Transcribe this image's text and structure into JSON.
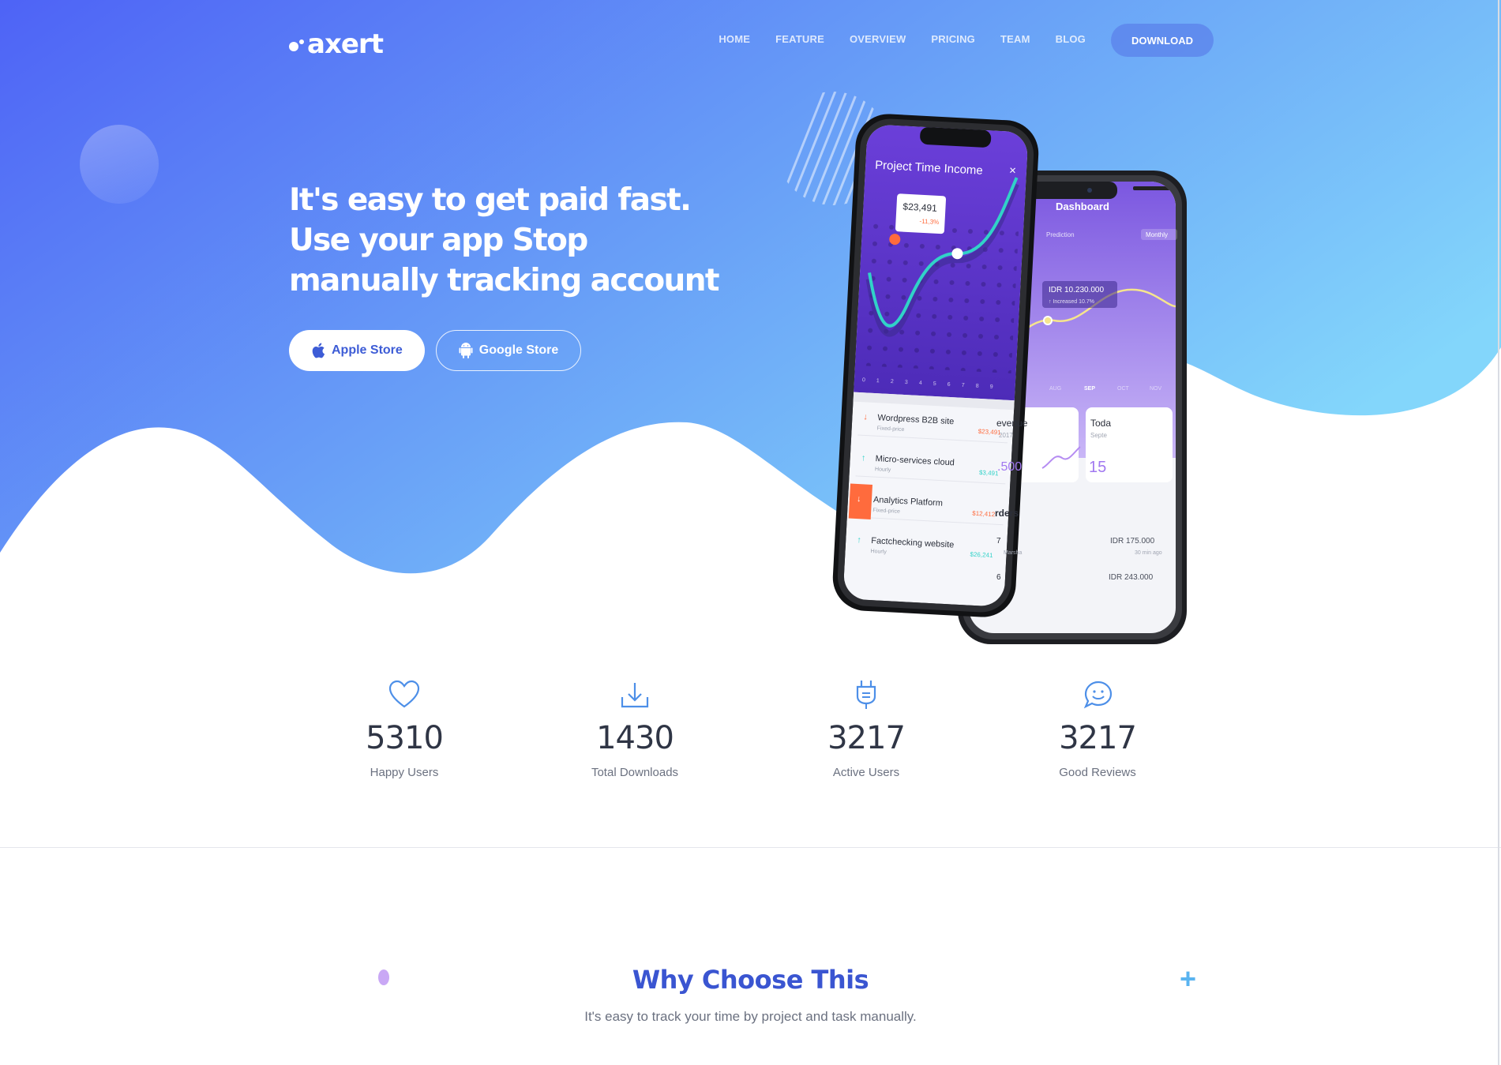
{
  "brand": {
    "name": "axert"
  },
  "nav": {
    "items": [
      {
        "label": "HOME"
      },
      {
        "label": "FEATURE"
      },
      {
        "label": "OVERVIEW"
      },
      {
        "label": "PRICING"
      },
      {
        "label": "TEAM"
      },
      {
        "label": "BLOG"
      }
    ],
    "download_label": "DOWNLOAD"
  },
  "hero": {
    "title": "It's easy to get paid fast. Use your app Stop manually tracking account",
    "apple_button": "Apple Store",
    "google_button": "Google Store"
  },
  "phone_front": {
    "title": "Project Time Income",
    "close": "×",
    "tooltip_value": "$23,491",
    "tooltip_change": "-11,3%",
    "days": [
      "0",
      "1",
      "2",
      "3",
      "4",
      "5",
      "6",
      "7",
      "8",
      "9"
    ],
    "rows": [
      {
        "name": "Wordpress B2B site",
        "sub": "Fixed-price",
        "amount": "$23,491",
        "dir": "down"
      },
      {
        "name": "Micro-services cloud",
        "sub": "Hourly",
        "amount": "$3,491",
        "dir": "up"
      },
      {
        "name": "Analytics Platform",
        "sub": "Fixed-price",
        "amount": "$12,412",
        "dir": "down"
      },
      {
        "name": "Factchecking website",
        "sub": "Hourly",
        "amount": "$26,241",
        "dir": "up"
      }
    ]
  },
  "phone_back": {
    "title": "Dashboard",
    "prediction": "Prediction",
    "period": "Monthly",
    "tooltip_value": "IDR 10.230.000",
    "tooltip_note": "↑ Increased 10.7%",
    "months": [
      "AUG",
      "SEP",
      "OCT",
      "NOV"
    ],
    "card1_title": "evenue",
    "card1_sub": "2017",
    "card1_value": ".500",
    "card2_title": "Toda",
    "card2_sub": "Septe",
    "card2_value": "15",
    "orders_title": "rders",
    "order1_left": "7",
    "order1_name": "Marsha",
    "order1_amount": "IDR 175.000",
    "order1_time": "30 min ago",
    "order2_left": "6",
    "order2_amount": "IDR 243.000"
  },
  "stats": [
    {
      "value": "5310",
      "label": "Happy Users",
      "icon": "heart-icon"
    },
    {
      "value": "1430",
      "label": "Total Downloads",
      "icon": "download-icon"
    },
    {
      "value": "3217",
      "label": "Active Users",
      "icon": "plug-icon"
    },
    {
      "value": "3217",
      "label": "Good Reviews",
      "icon": "smile-chat-icon"
    }
  ],
  "why": {
    "title": "Why Choose This",
    "subtitle": "It's easy to track your time by project and task manually."
  },
  "colors": {
    "hero_start": "#4f66f5",
    "hero_end": "#7ccdfb",
    "accent": "#3a55d1",
    "phone_purple": "#6a3fd6"
  }
}
